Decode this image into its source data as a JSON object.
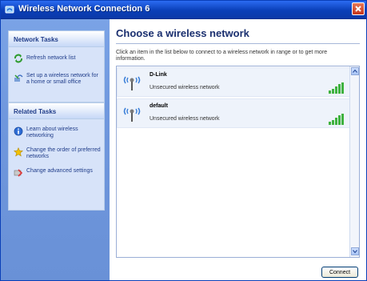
{
  "window": {
    "title": "Wireless Network Connection 6"
  },
  "sidebar": {
    "network_tasks": {
      "heading": "Network Tasks",
      "items": [
        {
          "label": "Refresh network list",
          "icon": "refresh-icon"
        },
        {
          "label": "Set up a wireless network for a home or small office",
          "icon": "wireless-setup-icon"
        }
      ]
    },
    "related_tasks": {
      "heading": "Related Tasks",
      "items": [
        {
          "label": "Learn about wireless networking",
          "icon": "info-icon"
        },
        {
          "label": "Change the order of preferred networks",
          "icon": "star-icon"
        },
        {
          "label": "Change advanced settings",
          "icon": "settings-icon"
        }
      ]
    }
  },
  "main": {
    "title": "Choose a wireless network",
    "description": "Click an item in the list below to connect to a wireless network in range or to get more information.",
    "networks": [
      {
        "name": "D-Link",
        "status": "Unsecured wireless network"
      },
      {
        "name": "default",
        "status": "Unsecured wireless network"
      }
    ],
    "connect_label": "Connect"
  },
  "colors": {
    "titlebar": "#0a3fb8",
    "sidebar": "#7aa3e6",
    "panel": "#d7e3f9",
    "heading_text": "#1a2f6f"
  }
}
